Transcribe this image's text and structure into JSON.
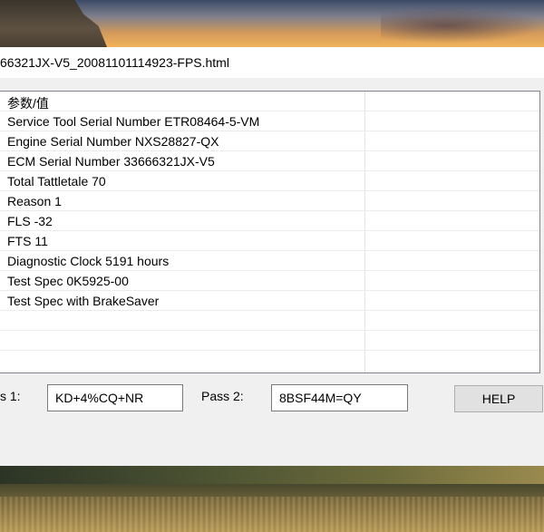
{
  "window": {
    "title": "66321JX-V5_20081101114923-FPS.html"
  },
  "list": {
    "header": "参数/值",
    "rows": [
      "Service Tool Serial Number ETR08464-5-VM",
      "Engine Serial Number NXS28827-QX",
      "ECM Serial Number 33666321JX-V5",
      "Total Tattletale 70",
      "Reason 1",
      "FLS -32",
      "FTS 11",
      "Diagnostic Clock 5191 hours",
      "Test Spec 0K5925-00",
      "Test Spec with BrakeSaver"
    ]
  },
  "controls": {
    "pass1_label": "s 1:",
    "pass1_value": "KD+4%CQ+NR",
    "pass2_label": "Pass 2:",
    "pass2_value": "8BSF44M=QY",
    "help_label": "HELP"
  }
}
